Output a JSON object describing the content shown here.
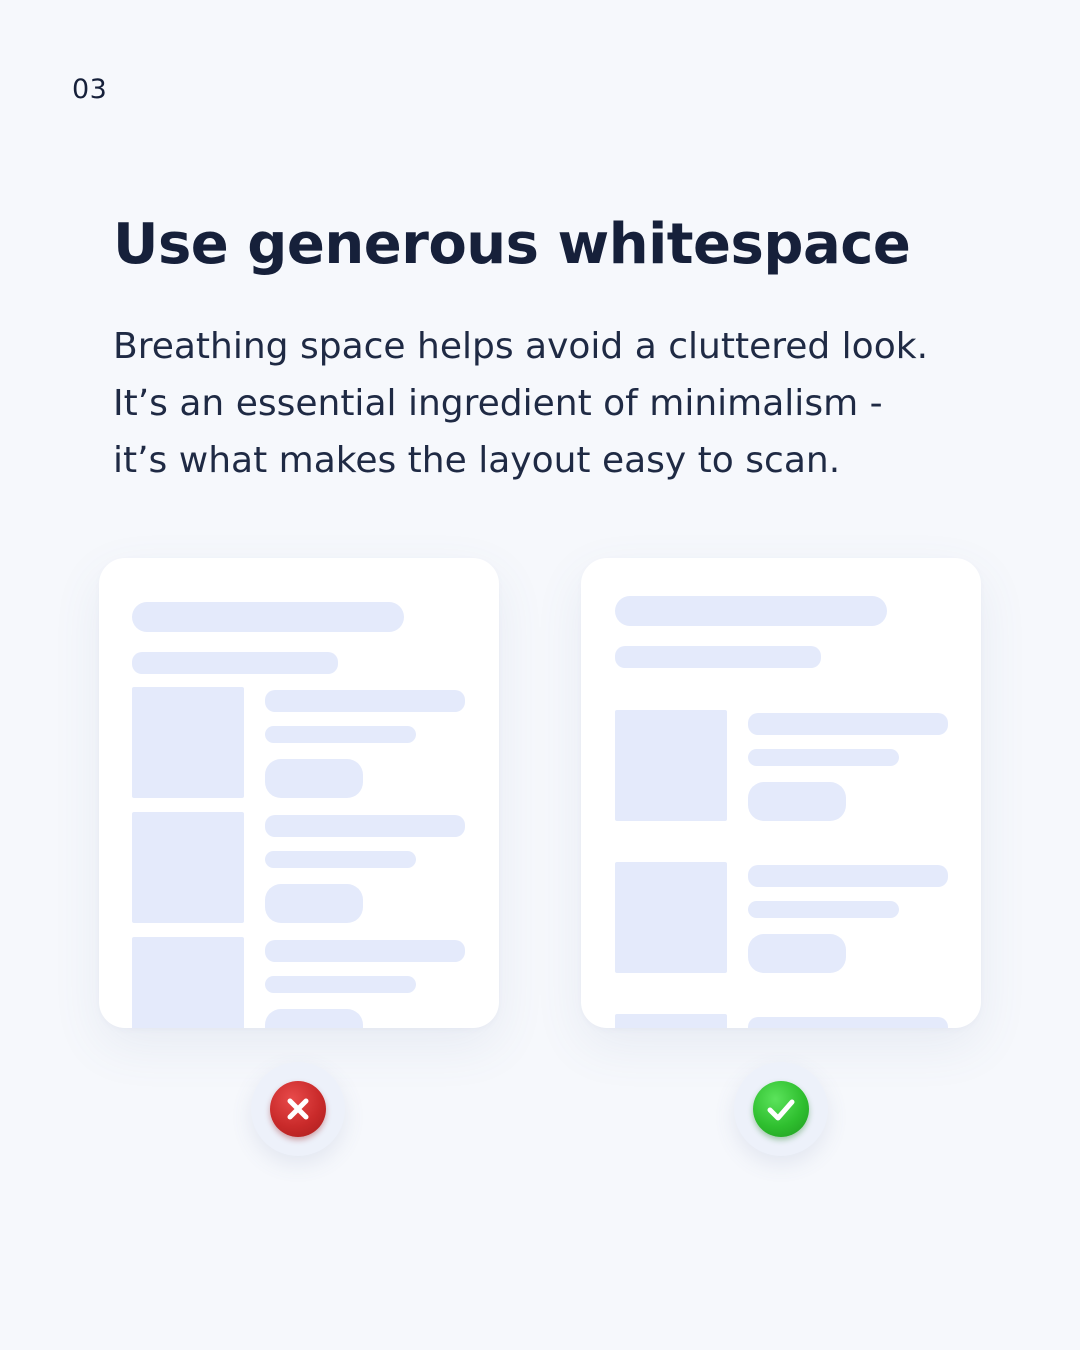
{
  "page_number": "03",
  "title": "Use generous whitespace",
  "body_lines": [
    "Breathing space helps avoid a cluttered look.",
    "It’s an essential ingredient of minimalism -",
    "it’s what makes the layout easy to scan."
  ],
  "examples": {
    "bad": {
      "verdict_icon": "cross-icon",
      "color": "#c92a2a"
    },
    "good": {
      "verdict_icon": "check-icon",
      "color": "#2fbf2f"
    }
  },
  "colors": {
    "background": "#f6f8fc",
    "text": "#16203a",
    "placeholder": "#e4eafb"
  }
}
